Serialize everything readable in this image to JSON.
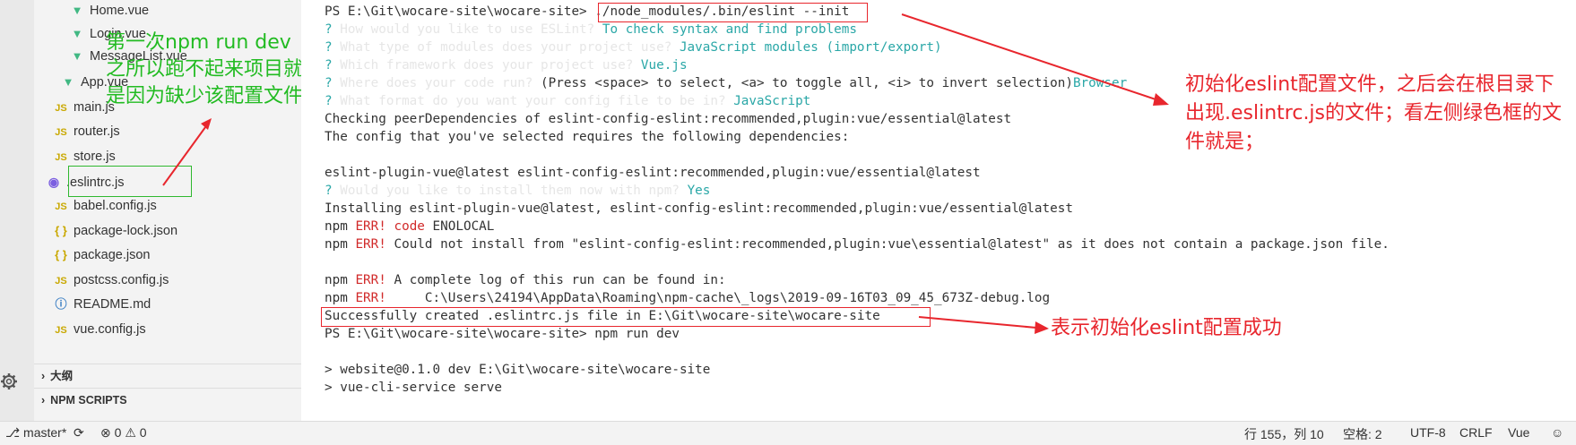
{
  "explorer": {
    "files": [
      {
        "name": "Home.vue",
        "icon": "vue-icon"
      },
      {
        "name": "Login.vue",
        "icon": "vue-icon"
      },
      {
        "name": "MessageList.vue",
        "icon": "vue-icon"
      },
      {
        "name": "App.vue",
        "icon": "vue-icon"
      },
      {
        "name": "main.js",
        "icon": "js-icon"
      },
      {
        "name": "router.js",
        "icon": "js-icon"
      },
      {
        "name": "store.js",
        "icon": "js-icon"
      },
      {
        "name": ".eslintrc.js",
        "icon": "eslint-icon"
      },
      {
        "name": "babel.config.js",
        "icon": "js-icon"
      },
      {
        "name": "package-lock.json",
        "icon": "json-icon"
      },
      {
        "name": "package.json",
        "icon": "json-icon"
      },
      {
        "name": "postcss.config.js",
        "icon": "js-icon"
      },
      {
        "name": "README.md",
        "icon": "info-icon"
      },
      {
        "name": "vue.config.js",
        "icon": "js-icon"
      }
    ],
    "icon_glyphs": {
      "vue": "▼",
      "js": "JS",
      "json": "{ }",
      "info": "ⓘ",
      "eslint": "◉"
    },
    "sections": [
      {
        "label": "大纲"
      },
      {
        "label": "NPM SCRIPTS"
      }
    ],
    "chevron": "›"
  },
  "annotations": {
    "green_note": "第一次npm run dev 之所以跑不起来项目就是因为缺少该配置文件",
    "red_note_1": "初始化eslint配置文件，之后会在根目录下出现.eslintrc.js的文件；看左侧绿色框的文件就是；",
    "red_note_2": "表示初始化eslint配置成功"
  },
  "terminal": {
    "prompt": "PS E:\\Git\\wocare-site\\wocare-site>",
    "init_command": "./node_modules/.bin/eslint --init",
    "q_mark": "?",
    "q1": "How would you like to use ESLint?",
    "a1": "To check syntax and find problems",
    "q2": "What type of modules does your project use?",
    "a2": "JavaScript modules (import/export)",
    "q3": "Which framework does your project use?",
    "a3": "Vue.js",
    "q4": "Where does your code run?",
    "q4_hint": "(Press <space> to select, <a> to toggle all, <i> to invert selection)",
    "a4": "Browser",
    "q5": "What format do you want your config file to be in?",
    "a5": "JavaScript",
    "checking": "Checking peerDependencies of eslint-config-eslint:recommended,plugin:vue/essential@latest",
    "requires": "The config that you've selected requires the following dependencies:",
    "deps": "eslint-plugin-vue@latest eslint-config-eslint:recommended,plugin:vue/essential@latest",
    "q6": "Would you like to install them now with npm?",
    "a6": "Yes",
    "installing": "Installing eslint-plugin-vue@latest, eslint-config-eslint:recommended,plugin:vue/essential@latest",
    "npm": "npm",
    "err": "ERR!",
    "err1_key": "code",
    "err1_val": "ENOLOCAL",
    "err2": "Could not install from \"eslint-config-eslint:recommended,plugin:vue\\essential@latest\" as it does not contain a package.json file.",
    "err3": "A complete log of this run can be found in:",
    "err4": "    C:\\Users\\24194\\AppData\\Roaming\\npm-cache\\_logs\\2019-09-16T03_09_45_673Z-debug.log",
    "success": "Successfully created .eslintrc.js file in E:\\Git\\wocare-site\\wocare-site",
    "run_command": "npm run dev",
    "out1": "> website@0.1.0 dev E:\\Git\\wocare-site\\wocare-site",
    "out2": "> vue-cli-service serve"
  },
  "status_bar": {
    "branch": "master*",
    "errors": "0",
    "warnings": "0",
    "position": "行 155，列 10",
    "spaces": "空格: 2",
    "encoding": "UTF-8",
    "eol": "CRLF",
    "language": "Vue"
  },
  "colors": {
    "annotation_red": "#e8262d",
    "annotation_green": "#22bb22",
    "terminal_cyan": "#2aa7a7",
    "error_red": "#d12a2a"
  }
}
